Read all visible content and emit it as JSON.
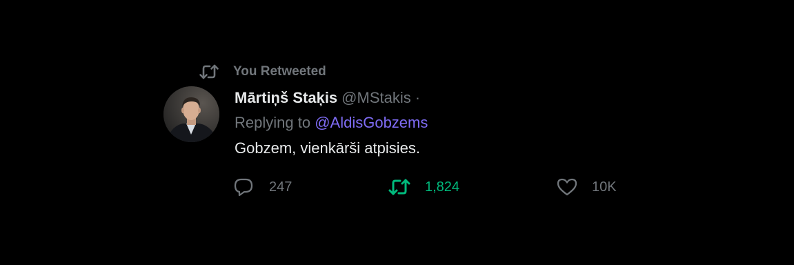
{
  "retweet_banner": {
    "icon": "retweet-icon",
    "label": "You Retweeted"
  },
  "tweet": {
    "author": {
      "avatar": "profile-photo",
      "display_name": "Mārtiņš Staķis",
      "handle": "@MStakis",
      "separator": "·"
    },
    "reply_to": {
      "prefix": "Replying to",
      "mention": "@AldisGobzems"
    },
    "text": "Gobzem, vienkārši atpisies.",
    "actions": {
      "reply": {
        "icon": "reply-icon",
        "count": "247"
      },
      "retweet": {
        "icon": "retweet-icon",
        "count": "1,824",
        "active": true
      },
      "like": {
        "icon": "heart-icon",
        "count": "10K"
      }
    }
  },
  "colors": {
    "background": "#000000",
    "primary_text": "#e7e9ea",
    "secondary_text": "#71767b",
    "mention": "#7f6cf5",
    "retweet_active": "#00ba7c"
  }
}
